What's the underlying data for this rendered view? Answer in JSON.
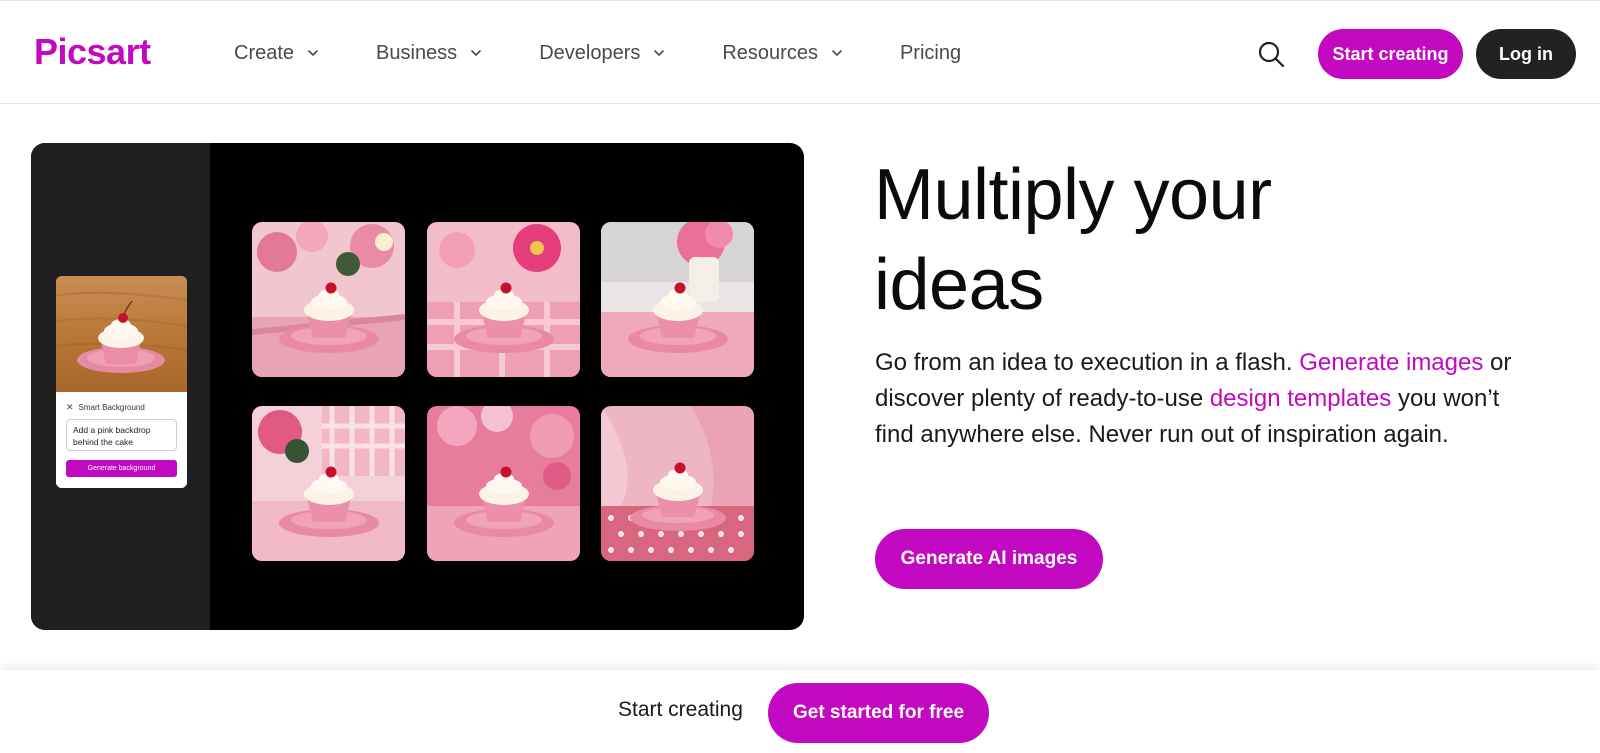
{
  "header": {
    "logo": "Picsart",
    "nav": [
      {
        "label": "Create",
        "has_dropdown": true
      },
      {
        "label": "Business",
        "has_dropdown": true
      },
      {
        "label": "Developers",
        "has_dropdown": true
      },
      {
        "label": "Resources",
        "has_dropdown": true
      },
      {
        "label": "Pricing",
        "has_dropdown": false
      }
    ],
    "search_icon": "search-icon",
    "start_creating": "Start creating",
    "log_in": "Log in"
  },
  "showcase": {
    "panel": {
      "title": "Smart Background",
      "prompt": "Add a pink backdrop behind the cake",
      "button": "Generate background"
    },
    "tiles": [
      "cupcake-roses",
      "cupcake-gingham",
      "cupcake-vase",
      "cupcake-tablecloth",
      "cupcake-blossoms",
      "cupcake-polka-dots"
    ]
  },
  "hero": {
    "headline_line1": "Multiply your",
    "headline_line2": "ideas",
    "desc_part1": "Go from an idea to execution in a flash. ",
    "desc_link1": "Generate images",
    "desc_part2": " or discover plenty of ready-to-use ",
    "desc_link2": "design templates",
    "desc_part3": " you won’t find anywhere else. Never run out of inspiration again.",
    "cta": "Generate AI images"
  },
  "bottom_bar": {
    "text": "Start creating",
    "cta": "Get started for free"
  },
  "colors": {
    "brand": "#c209c1",
    "dark": "#222222"
  }
}
